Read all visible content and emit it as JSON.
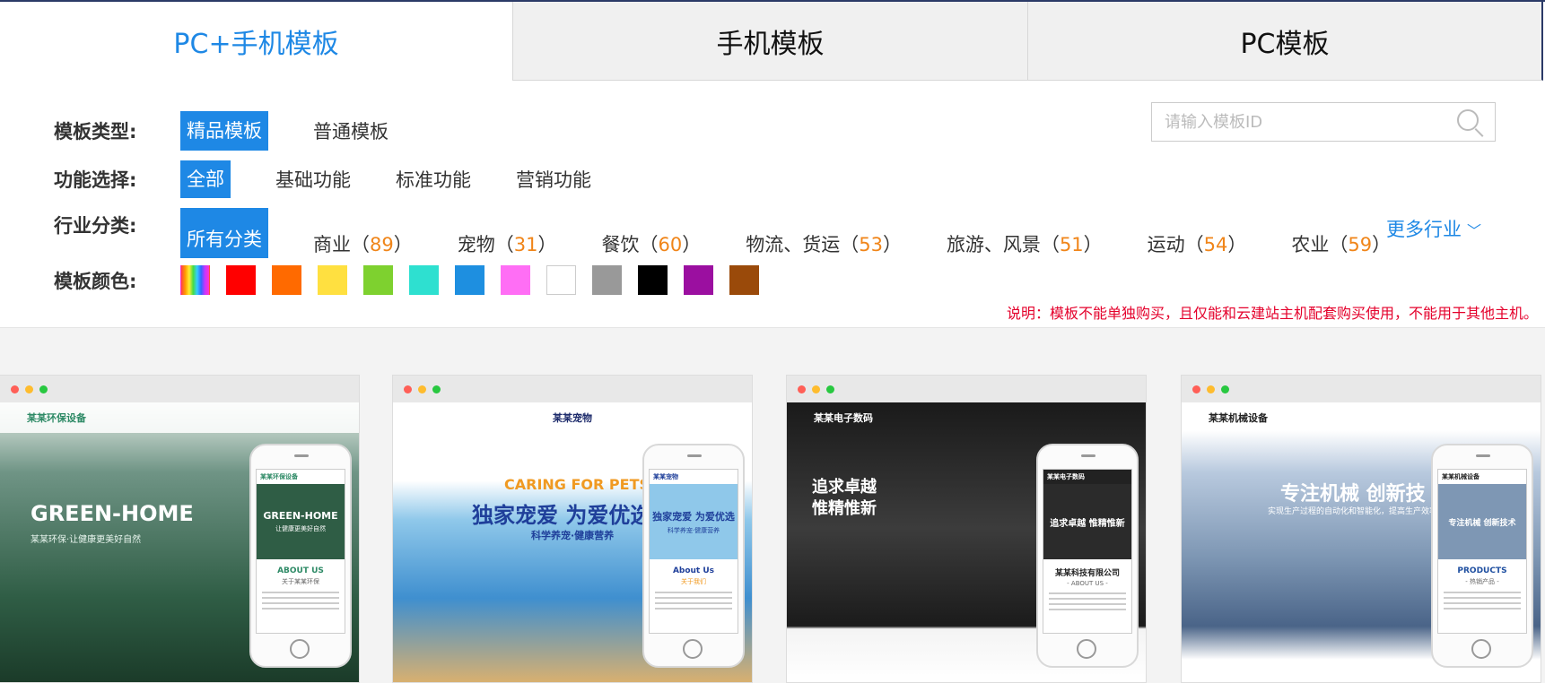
{
  "tabs": [
    {
      "label": "PC+手机模板",
      "active": true
    },
    {
      "label": "手机模板",
      "active": false
    },
    {
      "label": "PC模板",
      "active": false
    }
  ],
  "filters": {
    "type": {
      "label": "模板类型:",
      "options": [
        "精品模板",
        "普通模板"
      ],
      "selected": "精品模板"
    },
    "function": {
      "label": "功能选择:",
      "options": [
        "全部",
        "基础功能",
        "标准功能",
        "营销功能"
      ],
      "selected": "全部"
    },
    "industry": {
      "label": "行业分类:",
      "all_label": "所有分类",
      "items": [
        {
          "name": "商业",
          "count": "89"
        },
        {
          "name": "宠物",
          "count": "31"
        },
        {
          "name": "餐饮",
          "count": "60"
        },
        {
          "name": "物流、货运",
          "count": "53"
        },
        {
          "name": "旅游、风景",
          "count": "51"
        },
        {
          "name": "运动",
          "count": "54"
        },
        {
          "name": "农业",
          "count": "59"
        }
      ],
      "more_label": "更多行业"
    },
    "color": {
      "label": "模板颜色:",
      "swatches": [
        "rainbow",
        "#ff0000",
        "#ff6a00",
        "#ffe040",
        "#7ed12f",
        "#2ee0d0",
        "#1e8fe0",
        "#ff6ef5",
        "#ffffff",
        "#999999",
        "#000000",
        "#9b0fa0",
        "#9a4a0a"
      ]
    }
  },
  "search": {
    "placeholder": "请输入模板ID",
    "icon": "search-icon"
  },
  "note": "说明：模板不能单独购买，且仅能和云建站主机配套购买使用，不能用于其他主机。",
  "accent_color": "#1e88e5",
  "count_color": "#f08519",
  "cards": [
    {
      "site_name": "某某环保设备",
      "hero_title": "GREEN-HOME",
      "hero_sub": "某某环保·让健康更美好自然",
      "mobile_title": "GREEN-HOME",
      "mobile_sub": "让健康更美好自然",
      "section_title": "ABOUT US",
      "section_sub": "关于某某环保"
    },
    {
      "site_name": "某某宠物",
      "hero_title": "CARING FOR PETS",
      "hero_sub": "独家宠爱 为爱优选",
      "hero_tag": "科学养宠·健康营养",
      "mobile_title": "独家宠爱 为爱优选",
      "mobile_sub": "科学养宠·健康营养",
      "section_title": "About Us",
      "section_sub": "关于我们"
    },
    {
      "site_name": "某某电子数码",
      "hero_title": "追求卓越",
      "hero_sub": "惟精惟新",
      "mobile_title": "追求卓越 惟精惟新",
      "section_title": "某某科技有限公司",
      "section_sub": "- ABOUT US -"
    },
    {
      "site_name": "某某机械设备",
      "hero_title": "专注机械 创新技",
      "hero_sub": "实现生产过程的自动化和智能化，提高生产效率和",
      "mobile_title": "专注机械 创新技术",
      "section_title": "PRODUCTS",
      "section_sub": "- 热销产品 -"
    }
  ]
}
